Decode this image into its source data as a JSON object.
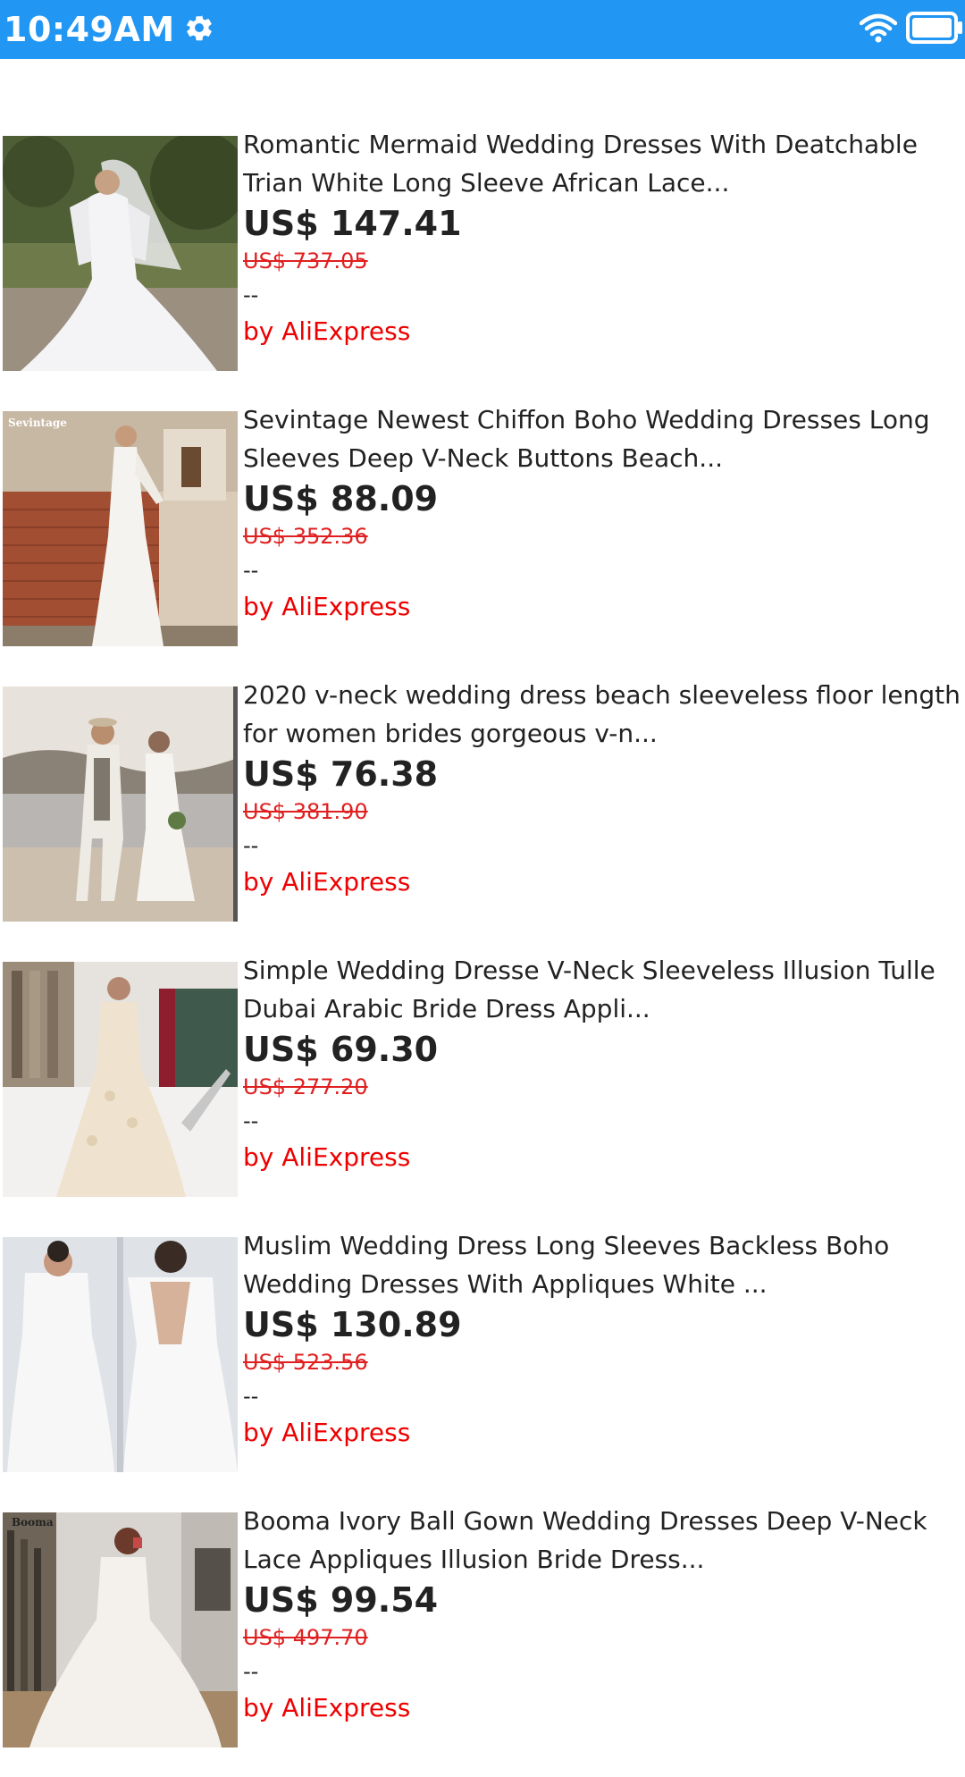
{
  "status_bar": {
    "time": "10:49AM",
    "color": "#2196f3",
    "icons": [
      "gear-icon",
      "wifi-icon",
      "battery-icon"
    ]
  },
  "products": [
    {
      "title": "Romantic Mermaid Wedding Dresses With Deatchable Trian White Long Sleeve African Lace...",
      "price": "US$ 147.41",
      "old_price": "US$ 737.05",
      "rating": "--",
      "seller": "by AliExpress",
      "image_label": ""
    },
    {
      "title": "Sevintage Newest Chiffon Boho Wedding Dresses Long Sleeves Deep V-Neck Buttons Beach...",
      "price": "US$ 88.09",
      "old_price": "US$ 352.36",
      "rating": "--",
      "seller": "by AliExpress",
      "image_label": "Sevintage"
    },
    {
      "title": "2020 v-neck wedding dress beach sleeveless floor length for women brides gorgeous v-n...",
      "price": "US$ 76.38",
      "old_price": "US$ 381.90",
      "rating": "--",
      "seller": "by AliExpress",
      "image_label": ""
    },
    {
      "title": "Simple Wedding Dresse V-Neck Sleeveless Illusion Tulle Dubai Arabic Bride Dress Appli...",
      "price": "US$ 69.30",
      "old_price": "US$ 277.20",
      "rating": "--",
      "seller": "by AliExpress",
      "image_label": ""
    },
    {
      "title": "Muslim Wedding Dress Long Sleeves Backless Boho Wedding Dresses With Appliques White ...",
      "price": "US$ 130.89",
      "old_price": "US$ 523.56",
      "rating": "--",
      "seller": "by AliExpress",
      "image_label": ""
    },
    {
      "title": "Booma Ivory Ball Gown Wedding Dresses Deep V-Neck Lace Appliques Illusion Bride Dress...",
      "price": "US$ 99.54",
      "old_price": "US$ 497.70",
      "rating": "--",
      "seller": "by AliExpress",
      "image_label": "Booma"
    }
  ]
}
